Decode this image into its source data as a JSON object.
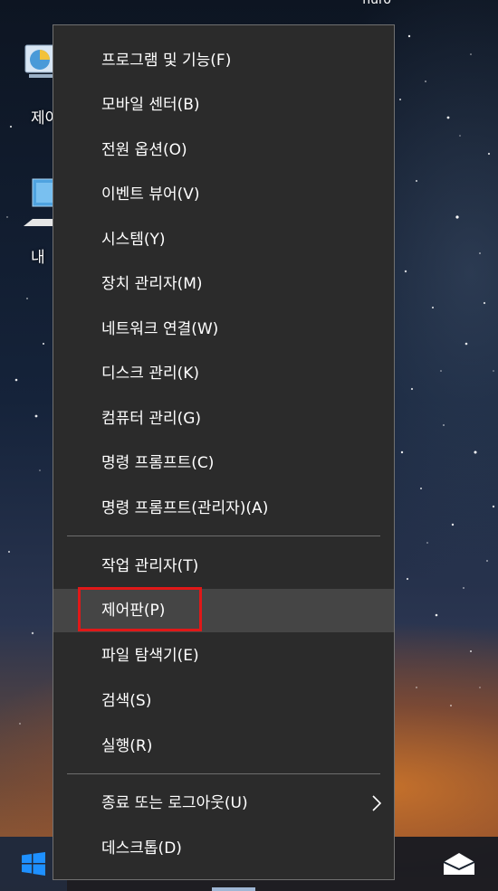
{
  "desktop": {
    "icons": [
      {
        "name": "control-panel",
        "label": "제어"
      },
      {
        "name": "this-pc",
        "label": "내"
      }
    ],
    "top_partial_text": "nuro"
  },
  "menu": {
    "group1": [
      {
        "label": "프로그램 및 기능(F)"
      },
      {
        "label": "모바일 센터(B)"
      },
      {
        "label": "전원 옵션(O)"
      },
      {
        "label": "이벤트 뷰어(V)"
      },
      {
        "label": "시스템(Y)"
      },
      {
        "label": "장치 관리자(M)"
      },
      {
        "label": "네트워크 연결(W)"
      },
      {
        "label": "디스크 관리(K)"
      },
      {
        "label": "컴퓨터 관리(G)"
      },
      {
        "label": "명령 프롬프트(C)"
      },
      {
        "label": "명령 프롬프트(관리자)(A)"
      }
    ],
    "group2": [
      {
        "label": "작업 관리자(T)"
      },
      {
        "label": "제어판(P)",
        "highlighted": true
      },
      {
        "label": "파일 탐색기(E)"
      },
      {
        "label": "검색(S)"
      },
      {
        "label": "실행(R)"
      }
    ],
    "group3": [
      {
        "label": "종료 또는 로그아웃(U)",
        "has_submenu": true
      },
      {
        "label": "데스크톱(D)"
      }
    ]
  },
  "colors": {
    "menu_bg": "#2b2b2b",
    "hover_bg": "#454545",
    "highlight_border": "#e01818",
    "windows_blue": "#1e90ff"
  }
}
